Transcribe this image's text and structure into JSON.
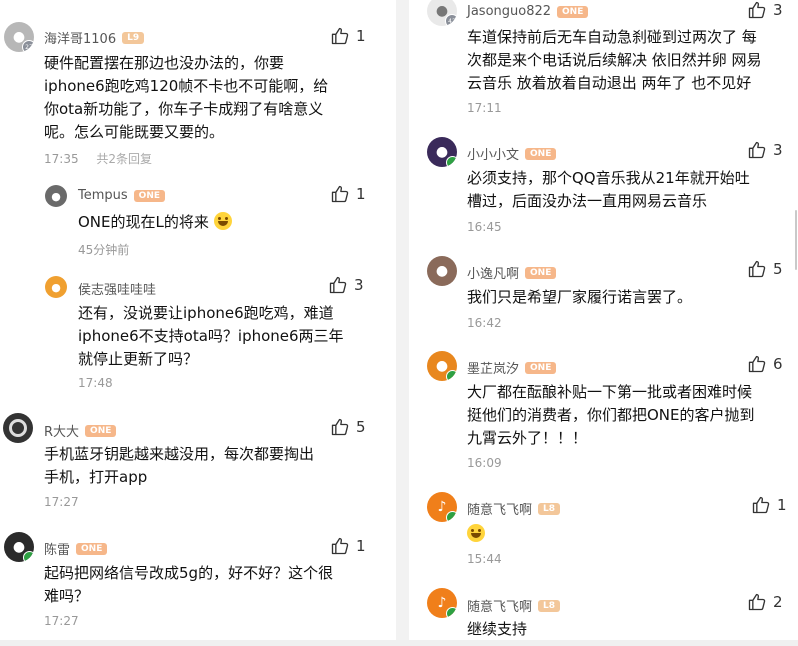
{
  "left": {
    "comments": [
      {
        "name": "海洋哥1106",
        "badge": "L9",
        "likes": "1",
        "lines": [
          "硬件配置摆在那边也没办法的，你要",
          "iphone6跑吃鸡120帧不卡也不可能啊，给",
          "你ota新功能了，你车子卡成翔了有啥意义",
          "呢。怎么可能既要又要的。"
        ],
        "time": "17:35",
        "replies": "共2条回复"
      },
      {
        "name": "Tempus",
        "badge": "ONE",
        "likes": "1",
        "lines": [
          "ONE的现在L的将来"
        ],
        "time": "45分钟前"
      },
      {
        "name": "侯志强哇哇哇",
        "likes": "3",
        "lines": [
          "还有，没说要让iphone6跑吃鸡，难道",
          "iphone6不支持ota吗？iphone6两三年",
          "就停止更新了吗？"
        ],
        "time": "17:48"
      },
      {
        "name": "R大大",
        "badge": "ONE",
        "likes": "5",
        "lines": [
          "手机蓝牙钥匙越来越没用，每次都要掏出",
          "手机，打开app"
        ],
        "time": "17:27"
      },
      {
        "name": "陈雷",
        "badge": "ONE",
        "likes": "1",
        "lines": [
          "起码把网络信号改成5g的，好不好？这个很",
          "难吗？"
        ],
        "time": "17:27"
      }
    ]
  },
  "right": {
    "comments": [
      {
        "name": "Jasonguo822",
        "badge": "ONE",
        "likes": "3",
        "lines": [
          "车道保持前后无车自动急刹碰到过两次了 每",
          "次都是来个电话说后续解决 依旧然并卵 网易",
          "云音乐 放着放着自动退出 两年了 也不见好"
        ],
        "time": "17:11"
      },
      {
        "name": "小小小文",
        "badge": "ONE",
        "likes": "3",
        "lines": [
          "必须支持，那个QQ音乐我从21年就开始吐",
          "槽过，后面没办法一直用网易云音乐"
        ],
        "time": "16:45"
      },
      {
        "name": "小逸凡啊",
        "badge": "ONE",
        "likes": "5",
        "lines": [
          "我们只是希望厂家履行诺言罢了。"
        ],
        "time": "16:42"
      },
      {
        "name": "墨芷岚汐",
        "badge": "ONE",
        "likes": "6",
        "lines": [
          "大厂都在酝酿补贴一下第一批或者困难时候",
          "挺他们的消费者，你们都把ONE的客户抛到",
          "九霄云外了！！！"
        ],
        "time": "16:09"
      },
      {
        "name": "随意飞飞啊",
        "badge": "L8",
        "likes": "1",
        "lines": [
          ""
        ],
        "time": "15:44"
      },
      {
        "name": "随意飞飞啊",
        "badge": "L8",
        "likes": "2",
        "lines": [
          "继续支持"
        ]
      }
    ]
  },
  "icons": {
    "like": "thumbs-up-icon"
  },
  "colors": {
    "badge": "#f6b78a",
    "time": "#999999",
    "avatar_level": "#2ea043"
  }
}
